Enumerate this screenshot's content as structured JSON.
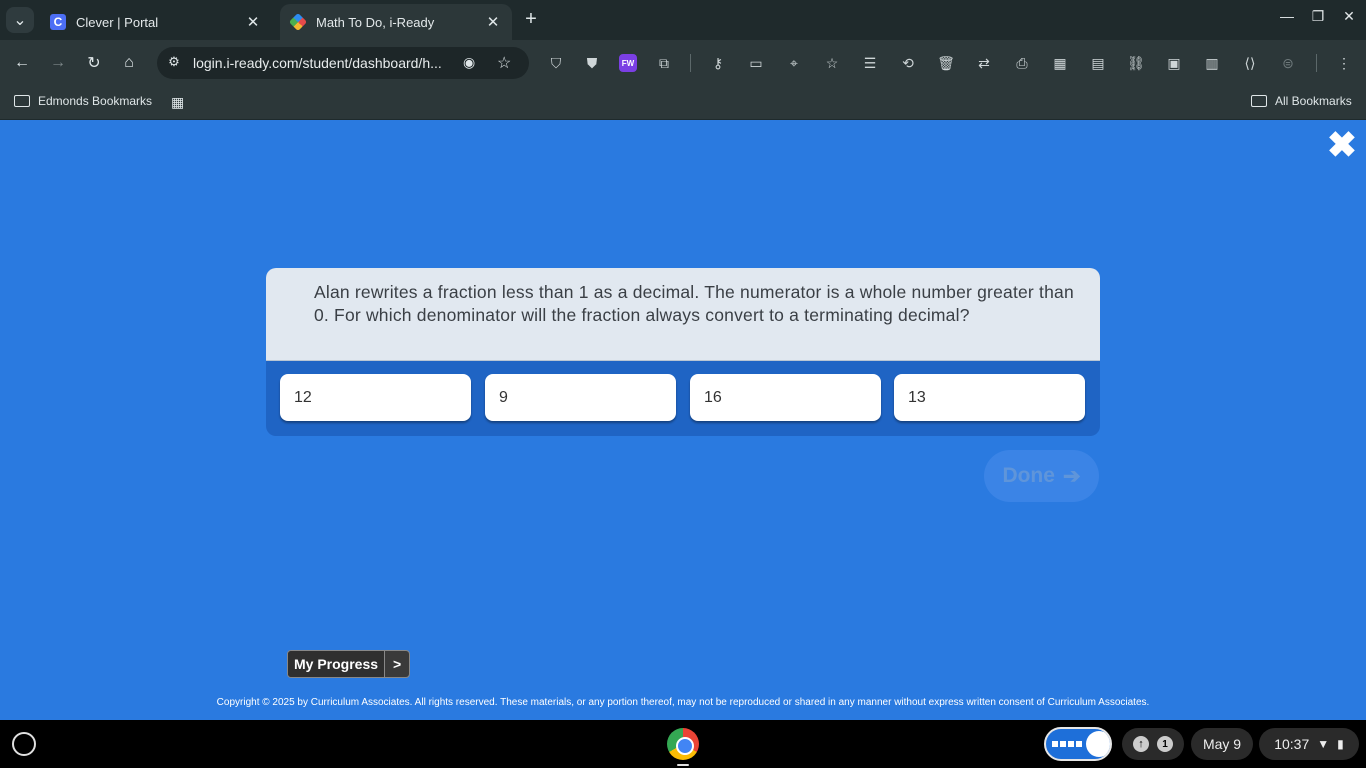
{
  "browser": {
    "tabs": [
      {
        "title": "Clever | Portal",
        "active": false
      },
      {
        "title": "Math To Do, i-Ready",
        "active": true
      }
    ],
    "favicon_clever": "C",
    "url": "login.i-ready.com/student/dashboard/h...",
    "extension_badge": "FW",
    "bookmarks": {
      "left": "Edmonds Bookmarks",
      "right": "All Bookmarks"
    },
    "icons": {
      "back": "back-arrow-icon",
      "forward": "forward-arrow-icon",
      "reload": "reload-icon",
      "home": "home-icon"
    }
  },
  "page": {
    "question": "Alan rewrites a fraction less than 1 as a decimal. The numerator is a whole number greater than 0. For which denominator will the fraction always convert to a terminating decimal?",
    "answers": [
      "12",
      "9",
      "16",
      "13"
    ],
    "done_label": "Done",
    "progress_label": "My Progress",
    "progress_arrow": ">",
    "copyright": "Copyright © 2025 by Curriculum Associates. All rights reserved. These materials, or any portion thereof, may not be reproduced or shared in any manner without express written consent of Curriculum Associates.",
    "colors": {
      "background": "#2a7ae0",
      "card_header": "#e1e8f0",
      "done_disabled": "#3b84e6"
    }
  },
  "shelf": {
    "notification_count": "1",
    "date": "May 9",
    "time": "10:37"
  }
}
